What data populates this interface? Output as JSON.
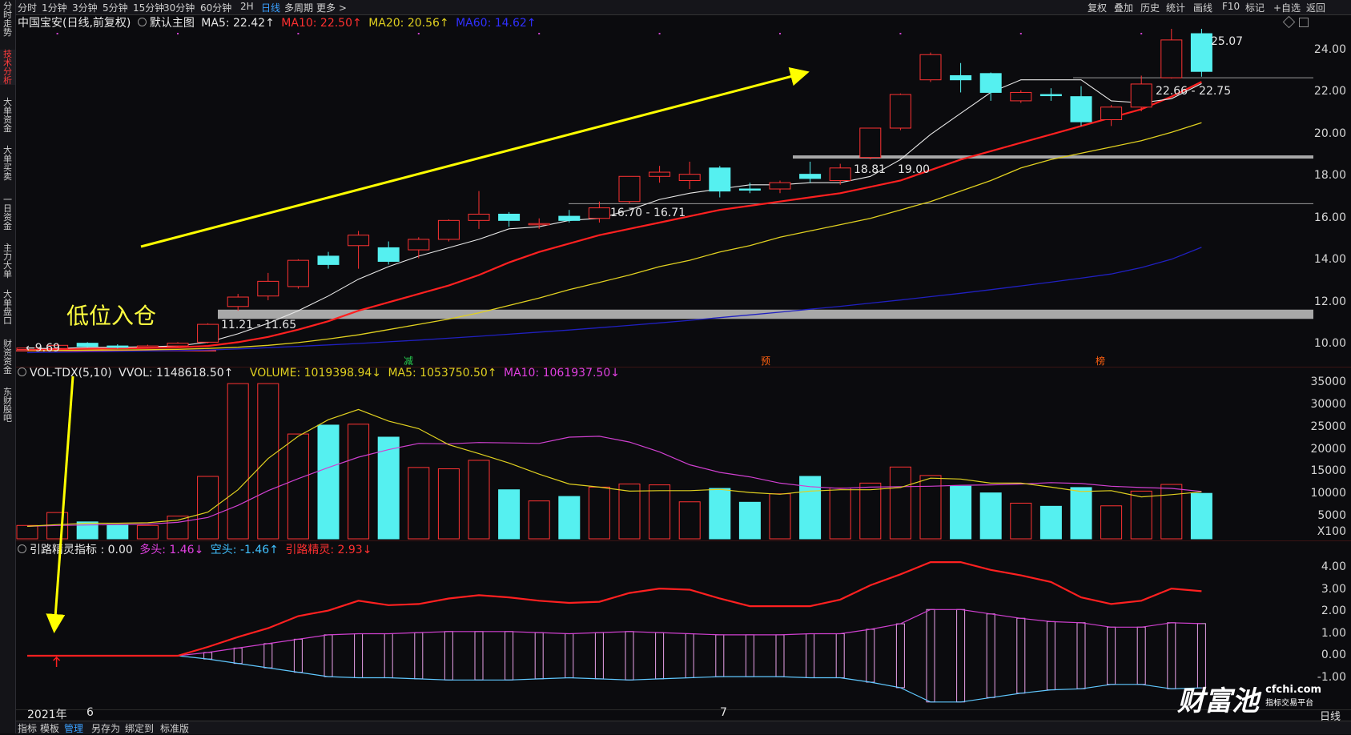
{
  "toolbar": {
    "left": [
      "分时",
      "1分钟",
      "3分钟",
      "5分钟",
      "15分钟",
      "30分钟",
      "60分钟",
      "2H",
      "日线",
      "多周期",
      "更多 >"
    ],
    "active": "日线",
    "right": [
      "复权",
      "叠加",
      "历史",
      "统计",
      "画线",
      "F10",
      "标记",
      "+自选",
      "返回"
    ]
  },
  "sidebar": {
    "tabs": [
      "分时走势",
      "技术分析",
      "大单资金",
      "大单买卖",
      "一日资金",
      "主力大单",
      "大单盘口",
      "财资资金",
      "东财股吧"
    ],
    "active": "技术分析"
  },
  "main": {
    "stock": "中国宝安(日线,前复权)",
    "template": "默认主图",
    "ma5": "MA5: 22.42↑",
    "ma10": "MA10: 22.50↑",
    "ma20": "MA20: 20.56↑",
    "ma60": "MA60: 14.62↑",
    "y_ticks": [
      "24.00",
      "22.00",
      "20.00",
      "18.00",
      "16.00",
      "14.00",
      "12.00",
      "10.00"
    ],
    "annotations": {
      "low": "←9.69",
      "zone1": "11.21 - 11.65",
      "zone2": "16.70 - 16.71",
      "zone3a": "18.81",
      "zone3b": "19.00",
      "zone4": "22.66 - 22.75",
      "high": "25.07",
      "entry": "低位入仓"
    },
    "markers": [
      "减",
      "预",
      "榜"
    ]
  },
  "volume": {
    "name": "VOL-TDX(5,10)",
    "vvol": "VVOL: 1148618.50↑",
    "volume": "VOLUME: 1019398.94↓",
    "ma5": "MA5: 1053750.50↑",
    "ma10": "MA10: 1061937.50↓",
    "y_ticks": [
      "35000",
      "30000",
      "25000",
      "20000",
      "15000",
      "10000",
      "5000",
      "X100"
    ]
  },
  "indicator": {
    "name": "引路精灵指标 : 0.00",
    "duotou": "多头: 1.46↓",
    "kongtou": "空头: -1.46↑",
    "jingling": "引路精灵: 2.93↓",
    "y_ticks": [
      "4.00",
      "3.00",
      "2.00",
      "1.00",
      "0.00",
      "-1.00"
    ]
  },
  "xaxis": {
    "labels": [
      "2021年",
      "6",
      "7"
    ],
    "period": "日线"
  },
  "bottombar": {
    "items": [
      "指标",
      "模板",
      "管理",
      "另存为",
      "绑定到",
      "标准版"
    ],
    "active": "管理"
  },
  "watermark": {
    "brand": "财富池",
    "site": "cfchi.com",
    "slogan": "指标交易平台"
  },
  "colors": {
    "up": "#ff3333",
    "down": "#55f0f0",
    "ma5": "#e8e8e8",
    "ma10": "#ff2020",
    "ma20": "#e0d020",
    "ma60": "#2020c0",
    "arrow": "#ffff00"
  },
  "chart_data": {
    "type": "candlestick",
    "candles": [
      {
        "o": 9.75,
        "c": 9.82,
        "h": 9.9,
        "l": 9.69
      },
      {
        "o": 9.8,
        "c": 9.95,
        "h": 10.05,
        "l": 9.75
      },
      {
        "o": 10.05,
        "c": 9.9,
        "h": 10.1,
        "l": 9.85
      },
      {
        "o": 9.92,
        "c": 9.85,
        "h": 10.0,
        "l": 9.8
      },
      {
        "o": 9.86,
        "c": 9.92,
        "h": 9.98,
        "l": 9.82
      },
      {
        "o": 9.92,
        "c": 10.05,
        "h": 10.1,
        "l": 9.88
      },
      {
        "o": 10.1,
        "c": 10.95,
        "h": 11.0,
        "l": 10.05
      },
      {
        "o": 11.8,
        "c": 12.25,
        "h": 12.4,
        "l": 11.6
      },
      {
        "o": 12.3,
        "c": 13.0,
        "h": 13.4,
        "l": 12.1
      },
      {
        "o": 12.75,
        "c": 14.0,
        "h": 14.05,
        "l": 12.65
      },
      {
        "o": 14.2,
        "c": 13.8,
        "h": 14.4,
        "l": 13.6
      },
      {
        "o": 14.7,
        "c": 15.2,
        "h": 15.4,
        "l": 13.6
      },
      {
        "o": 14.6,
        "c": 13.95,
        "h": 14.9,
        "l": 13.8
      },
      {
        "o": 14.5,
        "c": 15.0,
        "h": 15.1,
        "l": 14.1
      },
      {
        "o": 15.0,
        "c": 15.9,
        "h": 15.95,
        "l": 14.9
      },
      {
        "o": 15.9,
        "c": 16.2,
        "h": 17.3,
        "l": 15.5
      },
      {
        "o": 16.2,
        "c": 15.9,
        "h": 16.3,
        "l": 15.6
      },
      {
        "o": 15.7,
        "c": 15.75,
        "h": 16.0,
        "l": 15.5
      },
      {
        "o": 16.1,
        "c": 15.9,
        "h": 16.4,
        "l": 15.8
      },
      {
        "o": 16.0,
        "c": 16.5,
        "h": 16.8,
        "l": 15.8
      },
      {
        "o": 16.8,
        "c": 18.0,
        "h": 18.0,
        "l": 16.7
      },
      {
        "o": 18.0,
        "c": 18.2,
        "h": 18.5,
        "l": 17.7
      },
      {
        "o": 17.8,
        "c": 18.1,
        "h": 18.7,
        "l": 17.4
      },
      {
        "o": 18.4,
        "c": 17.3,
        "h": 18.5,
        "l": 17.0
      },
      {
        "o": 17.4,
        "c": 17.35,
        "h": 17.7,
        "l": 17.2
      },
      {
        "o": 17.4,
        "c": 17.7,
        "h": 17.8,
        "l": 17.2
      },
      {
        "o": 18.1,
        "c": 17.9,
        "h": 18.7,
        "l": 17.7
      },
      {
        "o": 17.8,
        "c": 18.4,
        "h": 18.6,
        "l": 17.6
      },
      {
        "o": 18.9,
        "c": 20.3,
        "h": 20.3,
        "l": 18.81
      },
      {
        "o": 20.3,
        "c": 21.9,
        "h": 21.95,
        "l": 20.2
      },
      {
        "o": 22.6,
        "c": 23.8,
        "h": 23.9,
        "l": 22.5
      },
      {
        "o": 22.8,
        "c": 22.6,
        "h": 23.4,
        "l": 22.0
      },
      {
        "o": 22.9,
        "c": 22.0,
        "h": 22.95,
        "l": 21.6
      },
      {
        "o": 21.6,
        "c": 22.0,
        "h": 22.1,
        "l": 21.5
      },
      {
        "o": 21.9,
        "c": 21.85,
        "h": 22.2,
        "l": 21.6
      },
      {
        "o": 21.8,
        "c": 20.6,
        "h": 22.3,
        "l": 20.4
      },
      {
        "o": 20.7,
        "c": 21.3,
        "h": 21.4,
        "l": 20.4
      },
      {
        "o": 21.3,
        "c": 22.4,
        "h": 22.8,
        "l": 21.1
      },
      {
        "o": 22.7,
        "c": 24.5,
        "h": 25.07,
        "l": 22.66
      },
      {
        "o": 24.8,
        "c": 23.0,
        "h": 25.07,
        "l": 22.75
      }
    ],
    "ma5": [
      9.8,
      9.8,
      9.85,
      9.86,
      9.88,
      9.92,
      10.1,
      10.5,
      11.0,
      11.6,
      12.3,
      13.1,
      13.7,
      14.2,
      14.6,
      15.0,
      15.5,
      15.6,
      15.9,
      16.0,
      16.4,
      16.9,
      17.2,
      17.4,
      17.6,
      17.6,
      17.7,
      17.7,
      18.0,
      18.8,
      20.0,
      21.0,
      22.0,
      22.6,
      22.6,
      22.6,
      21.6,
      21.5,
      21.7,
      22.42
    ],
    "ma10": [
      9.75,
      9.77,
      9.79,
      9.8,
      9.82,
      9.85,
      9.92,
      10.1,
      10.35,
      10.7,
      11.1,
      11.6,
      12.0,
      12.4,
      12.8,
      13.3,
      13.9,
      14.4,
      14.8,
      15.2,
      15.5,
      15.8,
      16.1,
      16.4,
      16.6,
      16.8,
      17.0,
      17.2,
      17.5,
      17.8,
      18.3,
      18.8,
      19.2,
      19.6,
      20.0,
      20.4,
      20.8,
      21.2,
      21.8,
      22.5
    ],
    "ma20": [
      9.7,
      9.71,
      9.72,
      9.73,
      9.74,
      9.76,
      9.8,
      9.86,
      9.95,
      10.08,
      10.25,
      10.45,
      10.7,
      10.95,
      11.2,
      11.5,
      11.85,
      12.2,
      12.6,
      12.95,
      13.3,
      13.7,
      14.0,
      14.4,
      14.7,
      15.1,
      15.4,
      15.7,
      16.0,
      16.4,
      16.8,
      17.3,
      17.8,
      18.4,
      18.8,
      19.1,
      19.4,
      19.7,
      20.1,
      20.56
    ],
    "ma60": [
      9.6,
      9.62,
      9.64,
      9.66,
      9.68,
      9.7,
      9.73,
      9.78,
      9.84,
      9.9,
      9.97,
      10.04,
      10.12,
      10.2,
      10.29,
      10.38,
      10.48,
      10.58,
      10.68,
      10.79,
      10.9,
      11.02,
      11.14,
      11.27,
      11.4,
      11.53,
      11.67,
      11.81,
      11.96,
      12.11,
      12.27,
      12.43,
      12.6,
      12.78,
      12.96,
      13.15,
      13.35,
      13.65,
      14.05,
      14.62
    ],
    "volume": [
      3000,
      5900,
      3800,
      3200,
      3000,
      5100,
      14000,
      34800,
      34800,
      23500,
      25500,
      25700,
      22800,
      16000,
      15700,
      17600,
      11000,
      8500,
      9500,
      11600,
      12300,
      12100,
      8300,
      11300,
      8200,
      10100,
      14000,
      11400,
      12500,
      16100,
      14200,
      11800,
      10300,
      8000,
      7300,
      11500,
      7400,
      10700,
      12200,
      10194
    ],
    "vol_ma5": [
      2800,
      3200,
      3500,
      3500,
      3600,
      4200,
      6000,
      11000,
      18000,
      23000,
      26700,
      29000,
      26400,
      24700,
      21100,
      19100,
      17000,
      14500,
      12300,
      11600,
      10700,
      10800,
      10800,
      11100,
      10400,
      10000,
      10700,
      11000,
      11000,
      11500,
      13600,
      13400,
      12500,
      12500,
      11600,
      10600,
      10800,
      9400,
      9900,
      10537
    ],
    "vol_ma10": [
      2800,
      3000,
      3100,
      3200,
      3300,
      3700,
      4800,
      7500,
      10800,
      13500,
      16000,
      18300,
      20000,
      21400,
      21300,
      21600,
      21500,
      21400,
      22800,
      23000,
      21700,
      19500,
      16600,
      14900,
      13900,
      12500,
      11700,
      11300,
      11600,
      11700,
      11800,
      12000,
      12100,
      12300,
      12600,
      12400,
      11800,
      11500,
      11300,
      10619
    ],
    "duotou": [
      0,
      0,
      0,
      0,
      0,
      0,
      0.15,
      0.35,
      0.55,
      0.75,
      0.95,
      1.0,
      1.0,
      1.05,
      1.1,
      1.1,
      1.1,
      1.05,
      1.0,
      1.05,
      1.1,
      1.05,
      1.0,
      0.95,
      0.95,
      0.95,
      1.0,
      1.0,
      1.2,
      1.45,
      2.1,
      2.1,
      1.9,
      1.7,
      1.55,
      1.5,
      1.3,
      1.3,
      1.5,
      1.46
    ],
    "kongtou": [
      0,
      0,
      0,
      0,
      0,
      0,
      -0.15,
      -0.35,
      -0.55,
      -0.75,
      -0.95,
      -1.0,
      -1.0,
      -1.05,
      -1.1,
      -1.1,
      -1.1,
      -1.05,
      -1.0,
      -1.05,
      -1.1,
      -1.05,
      -1.0,
      -0.95,
      -0.95,
      -0.95,
      -1.0,
      -1.0,
      -1.2,
      -1.45,
      -2.1,
      -2.1,
      -1.9,
      -1.7,
      -1.55,
      -1.5,
      -1.3,
      -1.3,
      -1.5,
      -1.46
    ],
    "jingling": [
      0,
      0,
      0,
      0,
      0,
      0,
      0.4,
      0.85,
      1.25,
      1.8,
      2.05,
      2.5,
      2.3,
      2.35,
      2.6,
      2.75,
      2.65,
      2.5,
      2.4,
      2.45,
      2.85,
      3.05,
      3.0,
      2.6,
      2.25,
      2.25,
      2.25,
      2.55,
      3.2,
      3.7,
      4.25,
      4.25,
      3.9,
      3.65,
      3.35,
      2.65,
      2.35,
      2.5,
      3.05,
      2.93
    ]
  }
}
